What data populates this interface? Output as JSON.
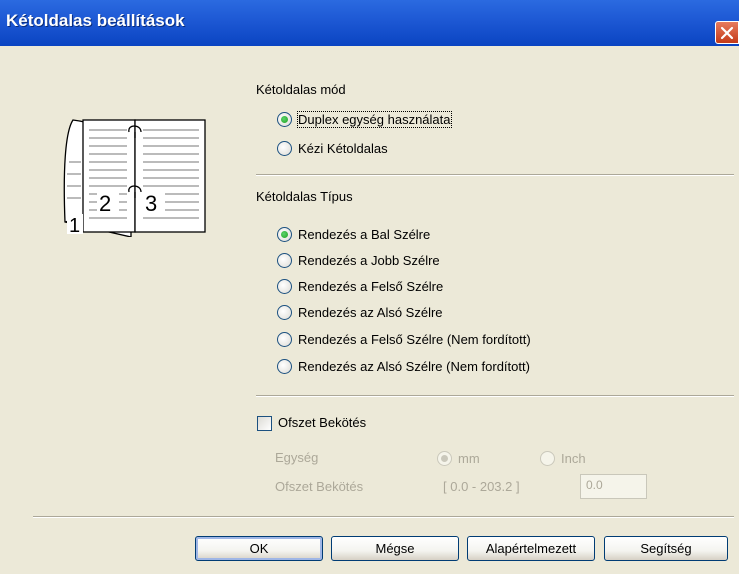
{
  "window": {
    "title": "Kétoldalas beállítások",
    "close_icon": "close-icon"
  },
  "duplex_mode": {
    "group_label": "Kétoldalas mód",
    "options": [
      {
        "label": "Duplex egység használata",
        "checked": true
      },
      {
        "label": "Kézi Kétoldalas",
        "checked": false
      }
    ]
  },
  "duplex_type": {
    "group_label": "Kétoldalas Típus",
    "options": [
      {
        "label": "Rendezés a Bal Szélre",
        "checked": true
      },
      {
        "label": "Rendezés a Jobb Szélre",
        "checked": false
      },
      {
        "label": "Rendezés a Felső Szélre",
        "checked": false
      },
      {
        "label": "Rendezés az Alsó Szélre",
        "checked": false
      },
      {
        "label": "Rendezés a Felső Szélre (Nem fordított)",
        "checked": false
      },
      {
        "label": "Rendezés az Alsó Szélre (Nem fordított)",
        "checked": false
      }
    ]
  },
  "binding_offset": {
    "checkbox_label": "Ofszet Bekötés",
    "checked": false,
    "unit_label": "Egység",
    "unit_options": [
      {
        "label": "mm",
        "checked": true
      },
      {
        "label": "Inch",
        "checked": false
      }
    ],
    "offset_label": "Ofszet Bekötés",
    "range_text": "[ 0.0 - 203.2 ]",
    "value": "0.0"
  },
  "preview": {
    "page_left": "2",
    "page_right": "3",
    "page_back": "1"
  },
  "buttons": {
    "ok": "OK",
    "cancel": "Mégse",
    "default": "Alapértelmezett",
    "help": "Segítség"
  },
  "colors": {
    "titlebar": "#0A44C2",
    "background": "#ECE9D8",
    "radio_checked": "#21A121",
    "disabled_text": "#ACA899"
  }
}
